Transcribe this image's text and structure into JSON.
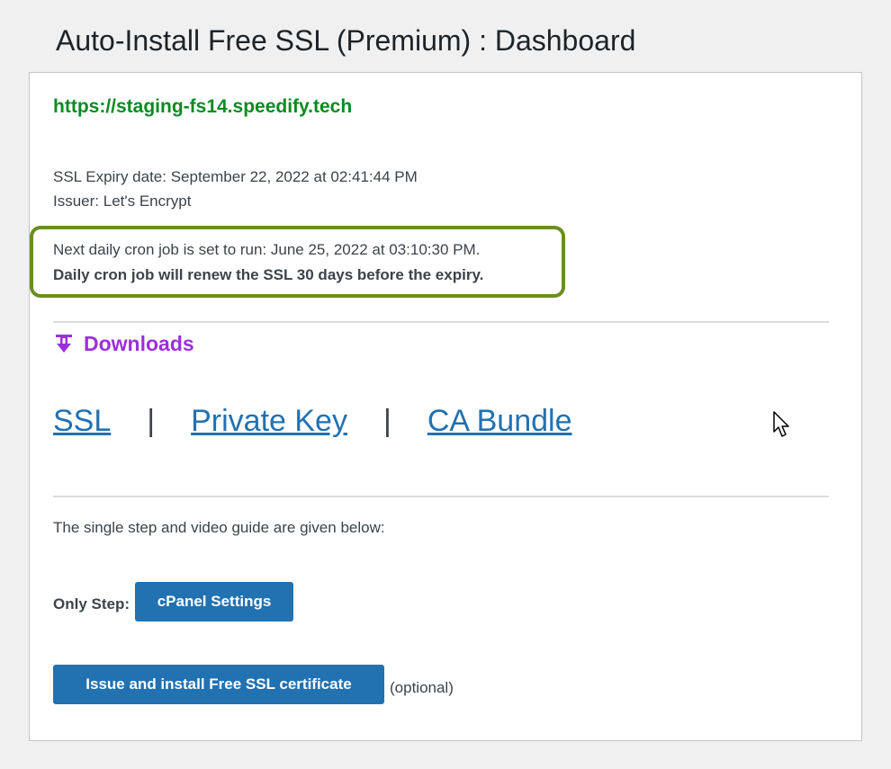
{
  "header": {
    "title": "Auto-Install Free SSL (Premium) : Dashboard"
  },
  "site": {
    "url": "https://staging-fs14.speedify.tech"
  },
  "ssl_info": {
    "expiry": "SSL Expiry date: September 22, 2022 at 02:41:44 PM",
    "issuer": "Issuer: Let's Encrypt"
  },
  "cron": {
    "next_run": "Next daily cron job is set to run: June 25, 2022 at 03:10:30 PM.",
    "renew_note": "Daily cron job will renew the SSL 30 days before the expiry."
  },
  "downloads": {
    "heading": "Downloads",
    "icon": "download-icon",
    "links": [
      {
        "label": "SSL"
      },
      {
        "label": "Private Key"
      },
      {
        "label": "CA Bundle"
      }
    ],
    "separator": "|"
  },
  "guide": {
    "text": "The single step and video guide are given below:",
    "only_step_label": "Only Step:",
    "cpanel_button": "cPanel Settings",
    "issue_button": "Issue and install Free SSL certificate",
    "optional_text": "(optional)"
  },
  "colors": {
    "url_green": "#0a8a22",
    "downloads_purple": "#9b30d9",
    "link_blue": "#2271b1",
    "highlight_border": "#6b8e23",
    "button_blue": "#2271b1"
  }
}
